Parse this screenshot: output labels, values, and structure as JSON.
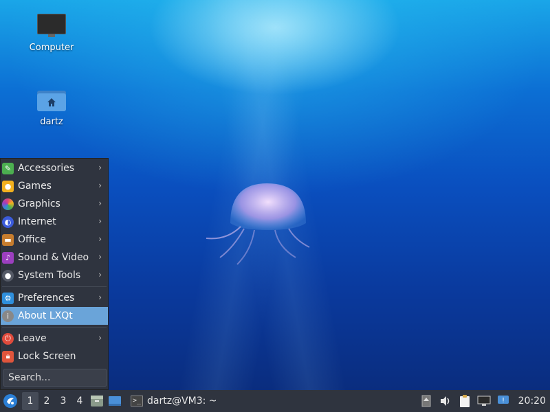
{
  "desktop": {
    "icons": [
      {
        "label": "Computer",
        "icon": "computer-icon"
      },
      {
        "label": "dartz",
        "icon": "home-folder-icon"
      }
    ]
  },
  "menu": {
    "items": [
      {
        "label": "Accessories",
        "icon": "accessories-icon",
        "submenu": true,
        "color": "#4caf50"
      },
      {
        "label": "Games",
        "icon": "games-icon",
        "submenu": true,
        "color": "#f2b01e"
      },
      {
        "label": "Graphics",
        "icon": "graphics-icon",
        "submenu": true,
        "color": "#e0457b"
      },
      {
        "label": "Internet",
        "icon": "internet-icon",
        "submenu": true,
        "color": "#3b5bdb"
      },
      {
        "label": "Office",
        "icon": "office-icon",
        "submenu": true,
        "color": "#c77d2e"
      },
      {
        "label": "Sound & Video",
        "icon": "sound-video-icon",
        "submenu": true,
        "color": "#9c3fbf"
      },
      {
        "label": "System Tools",
        "icon": "system-tools-icon",
        "submenu": true,
        "color": "#555a66"
      },
      {
        "label": "Preferences",
        "icon": "preferences-icon",
        "submenu": true,
        "color": "#2f8fdc"
      },
      {
        "label": "About LXQt",
        "icon": "info-icon",
        "submenu": false,
        "color": "#888888"
      },
      {
        "label": "Leave",
        "icon": "power-icon",
        "submenu": true,
        "color": "#e04b3c"
      },
      {
        "label": "Lock Screen",
        "icon": "lock-icon",
        "submenu": false,
        "color": "#e0553c"
      }
    ],
    "active_item": "About LXQt",
    "search_placeholder": "Search..."
  },
  "taskbar": {
    "desktops": [
      "1",
      "2",
      "3",
      "4"
    ],
    "active_desktop": "1",
    "task_label": "dartz@VM3: ~",
    "terminal_prompt": ">_",
    "clock": "20:20"
  },
  "colors": {
    "panel": "#2f343f",
    "highlight": "#6aa4d9"
  }
}
